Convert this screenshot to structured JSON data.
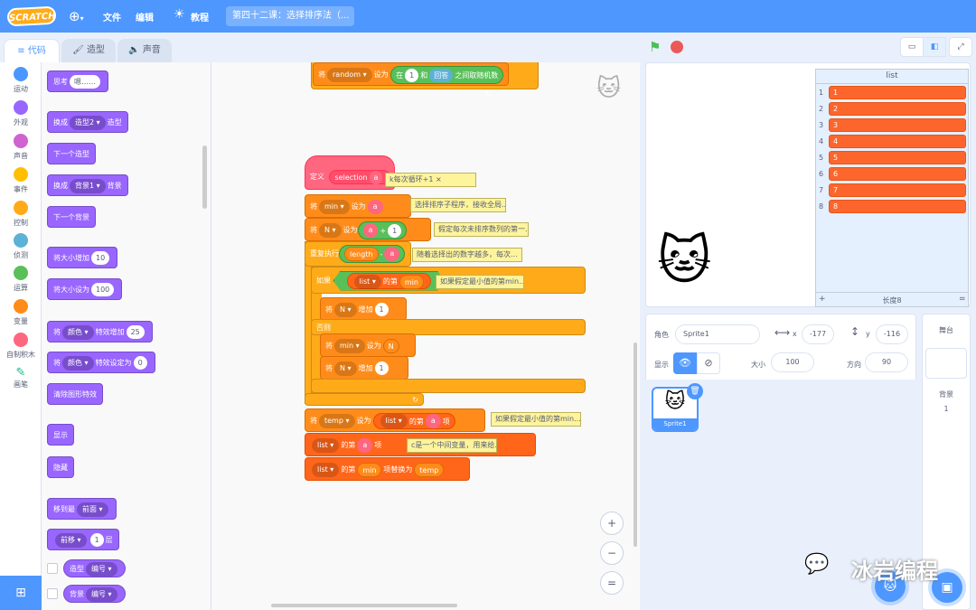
{
  "menubar": {
    "logo": "SCRATCH",
    "file": "文件",
    "edit": "编辑",
    "tutorials": "教程",
    "project_title": "第四十二课：选择排序法（..."
  },
  "tabs": {
    "code": "代码",
    "costumes": "造型",
    "sounds": "声音"
  },
  "categories": [
    {
      "label": "运动",
      "color": "#4c97ff"
    },
    {
      "label": "外观",
      "color": "#9966ff"
    },
    {
      "label": "声音",
      "color": "#cf63cf"
    },
    {
      "label": "事件",
      "color": "#ffbf00"
    },
    {
      "label": "控制",
      "color": "#ffab19"
    },
    {
      "label": "侦测",
      "color": "#5cb1d6"
    },
    {
      "label": "运算",
      "color": "#59c059"
    },
    {
      "label": "变量",
      "color": "#ff8c1a"
    },
    {
      "label": "自制积木",
      "color": "#ff6680"
    },
    {
      "label": "画笔",
      "color": "#0fbd8c"
    }
  ],
  "palette": {
    "think": "思考",
    "think_arg": "嗯……",
    "switch_costume": "换成",
    "costume2": "造型2",
    "costume_suffix": "造型",
    "next_costume": "下一个造型",
    "switch_backdrop": "换成",
    "backdrop1": "背景1",
    "backdrop_suffix": "背景",
    "next_backdrop": "下一个背景",
    "change_size": "将大小增加",
    "change_size_val": "10",
    "set_size": "将大小设为",
    "set_size_val": "100",
    "change_effect_a": "将",
    "effect_color": "颜色",
    "change_effect_b": "特效增加",
    "change_effect_val": "25",
    "set_effect_a": "将",
    "effect_color2": "颜色",
    "set_effect_b": "特效设定为",
    "set_effect_val": "0",
    "clear_effects": "清除图形特效",
    "show": "显示",
    "hide": "隐藏",
    "go_to_layer": "移到最",
    "front": "前面",
    "go_layer_a": "前移",
    "go_layer_val": "1",
    "go_layer_b": "层",
    "costume_rep": "造型",
    "number": "编号",
    "backdrop_rep": "背景",
    "number2": "编号"
  },
  "script": {
    "top_set": "将",
    "random_var": "random",
    "set_to": "设为",
    "pick": "在",
    "pick_from": "1",
    "and": "和",
    "answer": "回答",
    "between": "之间取随机数",
    "define": "定义",
    "proc_name": "selection",
    "param": "a",
    "comment_define": "k每次循环+1",
    "set_min_a": "将",
    "min_var": "min",
    "set_min_b": "设为",
    "set_min_val": "a",
    "comment_min": "选择排序子程序，接收全局...",
    "set_N_a": "将",
    "N_var": "N",
    "set_N_b": "设为",
    "set_N_val_a": "a",
    "plus": "+",
    "set_N_val_b": "1",
    "comment_N": "假定每次未排序数列的第一...",
    "repeat": "重复执行",
    "length": "length",
    "minus": "-",
    "rep_a": "a",
    "comment_repeat": "随着选择出的数字越多，每次...",
    "if": "如果",
    "list_var": "list",
    "item_of": "的第",
    "item_min": "min",
    "item_suffix": "项",
    "then": "那么",
    "comment_if": "如果假定最小值的第min...",
    "change_N_a": "将",
    "change_N_var": "N",
    "change_by": "增加",
    "change_N_val": "1",
    "else": "否则",
    "else_set_a": "将",
    "else_min": "min",
    "else_set_b": "设为",
    "else_N": "N",
    "else_change_a": "将",
    "else_change_var": "N",
    "else_change_b": "增加",
    "else_change_val": "1",
    "temp_set_a": "将",
    "temp_var": "temp",
    "temp_set_b": "设为",
    "temp_list": "list",
    "temp_item": "的第",
    "temp_a": "a",
    "temp_suffix": "项",
    "comment_temp": "如果假定最小值的第min...",
    "replace_list": "list",
    "replace_item": "的第",
    "replace_a": "a",
    "replace_mid": "项",
    "replace_min": "min",
    "replace_suffix": "项",
    "comment_replace": "c是一个中间变量，用来给...",
    "last_list": "list",
    "last_item": "的第",
    "last_min": "min",
    "last_replace": "项替换为",
    "last_temp": "temp"
  },
  "zoom": {
    "in": "+",
    "out": "−",
    "reset": "="
  },
  "list_monitor": {
    "title": "list",
    "items": [
      "1",
      "2",
      "3",
      "4",
      "5",
      "6",
      "7",
      "8"
    ],
    "indexes": [
      "1",
      "2",
      "3",
      "4",
      "5",
      "6",
      "7",
      "8"
    ],
    "add": "+",
    "length": "长度8",
    "resize": "="
  },
  "sprite": {
    "label": "角色",
    "name": "Sprite1",
    "x_label": "x",
    "x": "-177",
    "y_label": "y",
    "y": "-116",
    "show_label": "显示",
    "size_label": "大小",
    "size": "100",
    "direction_label": "方向",
    "direction": "90",
    "thumb_name": "Sprite1"
  },
  "stage_panel": {
    "title": "舞台",
    "backdrops_label": "背景",
    "backdrops_count": "1"
  },
  "watermark": "冰岩编程"
}
